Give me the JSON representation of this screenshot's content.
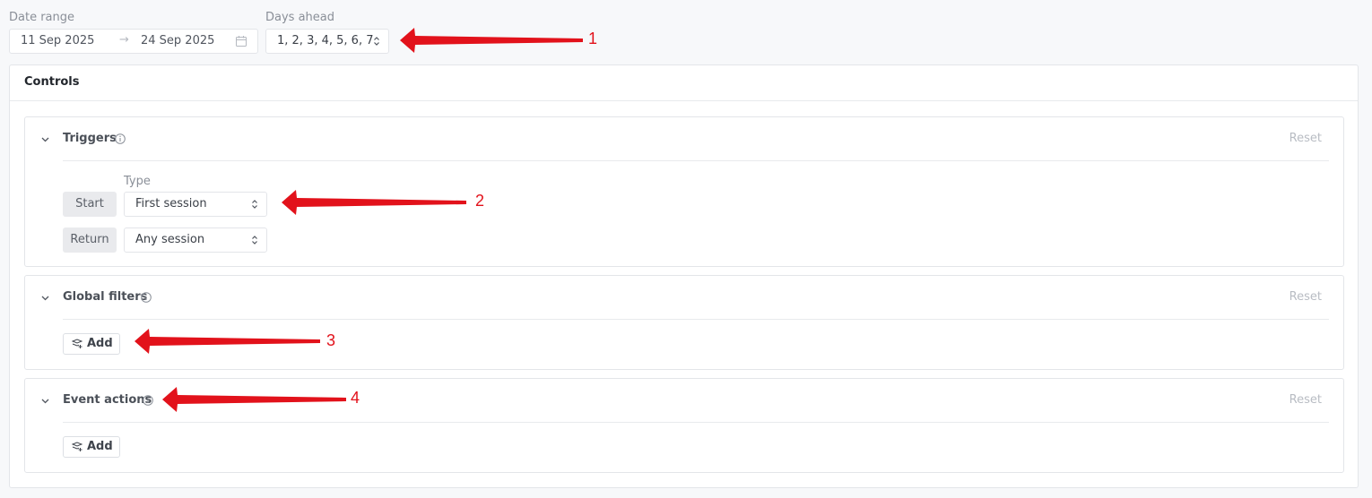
{
  "filters": {
    "date_range": {
      "label": "Date range",
      "start": "11 Sep 2025",
      "arrow": "→",
      "end": "24 Sep 2025"
    },
    "days_ahead": {
      "label": "Days ahead",
      "value": "1, 2, 3, 4, 5, 6, 7"
    }
  },
  "controls": {
    "title": "Controls",
    "triggers": {
      "title": "Triggers",
      "reset": "Reset",
      "type_label": "Type",
      "rows": [
        {
          "pill": "Start",
          "value": "First session"
        },
        {
          "pill": "Return",
          "value": "Any session"
        }
      ]
    },
    "global_filters": {
      "title": "Global filters",
      "reset": "Reset",
      "add": "Add"
    },
    "event_actions": {
      "title": "Event actions",
      "reset": "Reset",
      "add": "Add"
    }
  },
  "annotations": {
    "color": "#e2121b",
    "labels": [
      "1",
      "2",
      "3",
      "4"
    ]
  },
  "icons": [
    "calendar-icon",
    "chevron-updown-icon",
    "chevron-down-icon",
    "info-icon",
    "filter-add-icon"
  ]
}
